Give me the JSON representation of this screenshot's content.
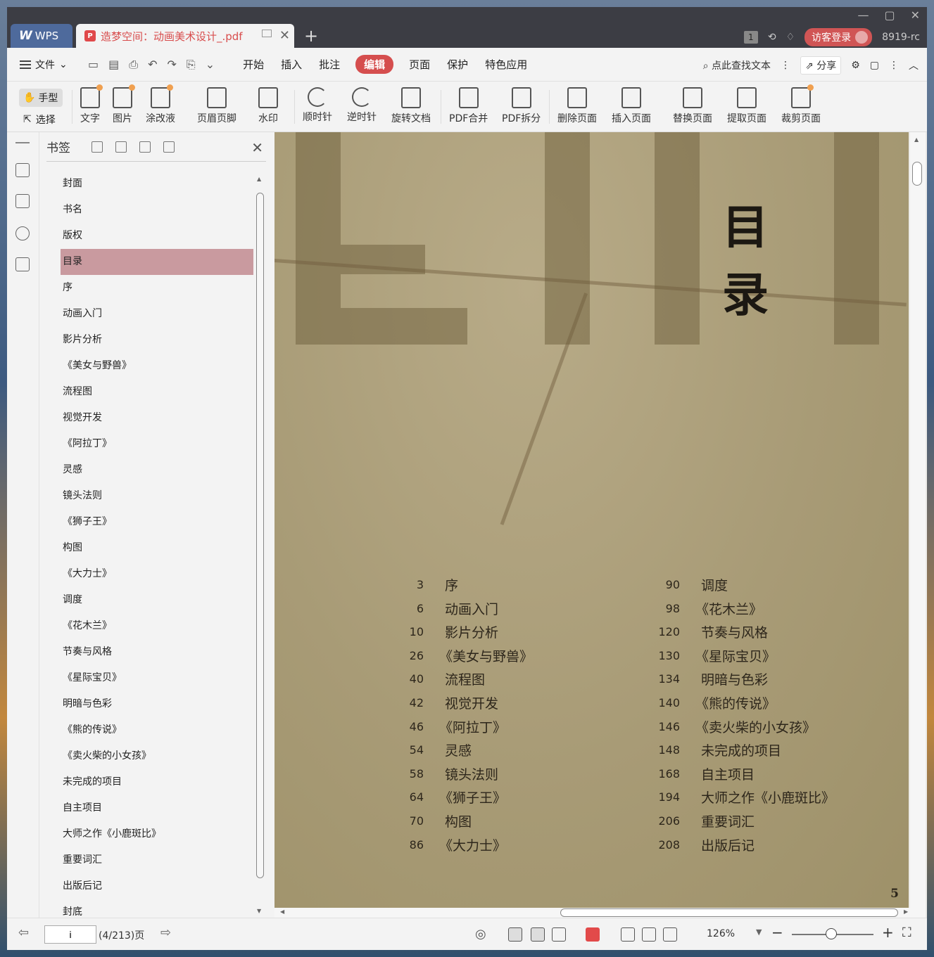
{
  "app": {
    "brand": "WPS",
    "doc_tab_title": "造梦空间：动画美术设计_.pdf",
    "tab_count_badge": "1",
    "login_label": "访客登录",
    "user_suffix": "8919-rc"
  },
  "menubar": {
    "file_label": "文件",
    "tabs": [
      "开始",
      "插入",
      "批注",
      "编辑",
      "页面",
      "保护",
      "特色应用"
    ],
    "active_tab": "编辑",
    "search_label": "点此查找文本",
    "share_label": "分享"
  },
  "ribbon": {
    "hand_label": "手型",
    "select_label": "选择",
    "tools": [
      "文字",
      "图片",
      "涂改液",
      "页眉页脚",
      "水印",
      "顺时针",
      "逆时针",
      "旋转文档",
      "PDF合并",
      "PDF拆分",
      "删除页面",
      "插入页面",
      "替换页面",
      "提取页面",
      "裁剪页面"
    ]
  },
  "bookmarks": {
    "title": "书签",
    "items": [
      "封面",
      "书名",
      "版权",
      "目录",
      "序",
      "动画入门",
      "影片分析",
      "《美女与野兽》",
      "流程图",
      "视觉开发",
      "《阿拉丁》",
      "灵感",
      "镜头法则",
      "《狮子王》",
      "构图",
      "《大力士》",
      "调度",
      "《花木兰》",
      "节奏与风格",
      "《星际宝贝》",
      "明暗与色彩",
      "《熊的传说》",
      "《卖火柴的小女孩》",
      "未完成的项目",
      "自主项目",
      "大师之作《小鹿斑比》",
      "重要词汇",
      "出版后记",
      "封底"
    ],
    "selected": "目录"
  },
  "document": {
    "heading": "目录",
    "page_number": "5",
    "toc_left": [
      {
        "num": "3",
        "title": "序"
      },
      {
        "num": "6",
        "title": "动画入门"
      },
      {
        "num": "10",
        "title": "影片分析"
      },
      {
        "num": "26",
        "title": "《美女与野兽》"
      },
      {
        "num": "40",
        "title": "流程图"
      },
      {
        "num": "42",
        "title": "视觉开发"
      },
      {
        "num": "46",
        "title": "《阿拉丁》"
      },
      {
        "num": "54",
        "title": "灵感"
      },
      {
        "num": "58",
        "title": "镜头法则"
      },
      {
        "num": "64",
        "title": "《狮子王》"
      },
      {
        "num": "70",
        "title": "构图"
      },
      {
        "num": "86",
        "title": "《大力士》"
      }
    ],
    "toc_right": [
      {
        "num": "90",
        "title": "调度"
      },
      {
        "num": "98",
        "title": "《花木兰》"
      },
      {
        "num": "120",
        "title": "节奏与风格"
      },
      {
        "num": "130",
        "title": "《星际宝贝》"
      },
      {
        "num": "134",
        "title": "明暗与色彩"
      },
      {
        "num": "140",
        "title": "《熊的传说》"
      },
      {
        "num": "146",
        "title": "《卖火柴的小女孩》"
      },
      {
        "num": "148",
        "title": "未完成的项目"
      },
      {
        "num": "168",
        "title": "自主项目"
      },
      {
        "num": "194",
        "title": "大师之作《小鹿斑比》"
      },
      {
        "num": "206",
        "title": "重要词汇"
      },
      {
        "num": "208",
        "title": "出版后记"
      }
    ]
  },
  "status": {
    "page_input_value": "i",
    "page_info": "(4/213)页",
    "zoom": "126%"
  },
  "colors": {
    "accent": "#d54e4e",
    "titlebar": "#3c3d44",
    "bookmark_selected": "#c99a9f",
    "page_bg": "#a89b76"
  }
}
